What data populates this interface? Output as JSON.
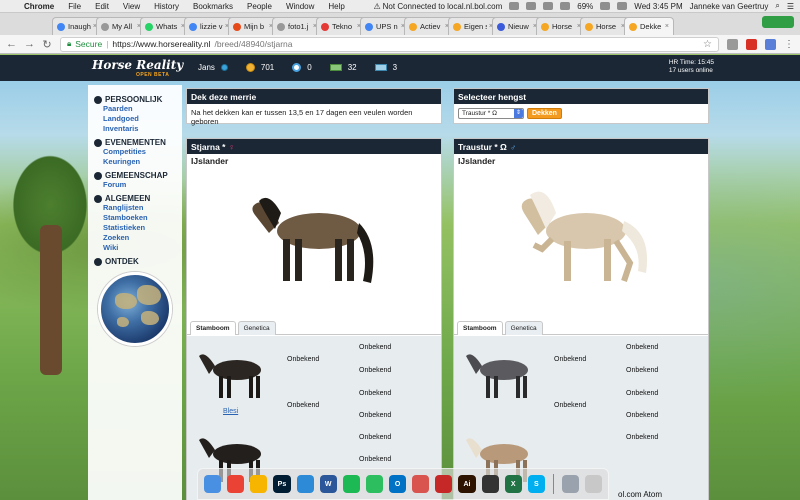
{
  "menubar": {
    "app_name": "Chrome",
    "items": [
      "File",
      "Edit",
      "View",
      "History",
      "Bookmarks",
      "People",
      "Window",
      "Help"
    ],
    "status_text": "Not Connected to local.nl.bol.com",
    "battery": "69%",
    "datetime": "Wed 3:45 PM",
    "user": "Janneke van Geertruy"
  },
  "browser": {
    "tabs": [
      {
        "title": "Inaugh",
        "color": "#4285f4"
      },
      {
        "title": "My All",
        "color": "#999999"
      },
      {
        "title": "Whats",
        "color": "#25d366"
      },
      {
        "title": "lizzie v",
        "color": "#4285f4"
      },
      {
        "title": "Mijn b",
        "color": "#e64a19"
      },
      {
        "title": "foto1.j",
        "color": "#999999"
      },
      {
        "title": "Tekno",
        "color": "#e53935"
      },
      {
        "title": "UPS n",
        "color": "#4285f4"
      },
      {
        "title": "Actiev",
        "color": "#f5a623"
      },
      {
        "title": "Eigen s",
        "color": "#f5a623"
      },
      {
        "title": "Nieuw",
        "color": "#3b5bdb"
      },
      {
        "title": "Horse",
        "color": "#f5a623"
      },
      {
        "title": "Horse",
        "color": "#f5a623"
      },
      {
        "title": "Dekke",
        "color": "#f5a623"
      }
    ],
    "secure_label": "Secure",
    "url_host": "https://www.horsereality.nl",
    "url_path": "/breed/48940/stjarna"
  },
  "site": {
    "logo_text": "Horse Reality",
    "logo_sub": "OPEN BETA",
    "username": "Jans",
    "currency": [
      {
        "icon": "gold-coin",
        "value": "701"
      },
      {
        "icon": "blue-coin",
        "value": "0"
      },
      {
        "icon": "green-money",
        "value": "32"
      },
      {
        "icon": "blue-money",
        "value": "3"
      }
    ],
    "hr_time": "HR Time: 15:45",
    "users_online": "17 users online"
  },
  "sidebar": {
    "sections": [
      {
        "title": "PERSOONLIJK",
        "links": [
          "Paarden",
          "Landgoed",
          "Inventaris"
        ]
      },
      {
        "title": "EVENEMENTEN",
        "links": [
          "Competities",
          "Keuringen"
        ]
      },
      {
        "title": "GEMEENSCHAP",
        "links": [
          "Forum"
        ]
      },
      {
        "title": "ALGEMEEN",
        "links": [
          "Ranglijsten",
          "Stamboeken",
          "Statistieken",
          "Zoeken",
          "Wiki"
        ]
      },
      {
        "title": "ONTDEK",
        "links": []
      }
    ]
  },
  "breed_panel": {
    "title": "Dek deze merrie",
    "message": "Na het dekken kan er tussen 13,5 en 17 dagen een veulen worden geboren"
  },
  "stallion_select": {
    "title": "Selecteer hengst",
    "selected": "Traustur * Ω",
    "button_label": "Dekken"
  },
  "mare": {
    "name": "Stjarna *",
    "gender_symbol": "♀",
    "breed": "IJslander",
    "tabs": [
      "Stamboom",
      "Genetica"
    ],
    "pedigree": {
      "parent_name": "Blesi",
      "cells": [
        "Onbekend",
        "Onbekend",
        "Onbekend",
        "Onbekend",
        "Onbekend",
        "Onbekend",
        "Onbekend",
        "Onbekend"
      ]
    }
  },
  "stallion": {
    "name": "Traustur * Ω",
    "gender_symbol": "♂",
    "breed": "IJslander",
    "tabs": [
      "Stamboom",
      "Genetica"
    ],
    "pedigree": {
      "cells": [
        "Onbekend",
        "Onbekend",
        "Onbekend",
        "Onbekend",
        "Onbekend",
        "Onbekend",
        "Onbekend"
      ]
    }
  },
  "dock": {
    "apps": [
      {
        "name": "finder",
        "color": "#4a90e2",
        "label": ""
      },
      {
        "name": "chrome",
        "color": "#ea4335",
        "label": ""
      },
      {
        "name": "sketch",
        "color": "#f7b500",
        "label": ""
      },
      {
        "name": "photoshop",
        "color": "#001d34",
        "label": "Ps"
      },
      {
        "name": "skype-blue",
        "color": "#2c8ad6",
        "label": ""
      },
      {
        "name": "word",
        "color": "#2b579a",
        "label": "W"
      },
      {
        "name": "spotify",
        "color": "#1db954",
        "label": ""
      },
      {
        "name": "evernote",
        "color": "#2dbe60",
        "label": ""
      },
      {
        "name": "outlook",
        "color": "#0072c6",
        "label": "O"
      },
      {
        "name": "wunderlist",
        "color": "#d9534f",
        "label": ""
      },
      {
        "name": "acrobat",
        "color": "#c62828",
        "label": ""
      },
      {
        "name": "illustrator",
        "color": "#2d1300",
        "label": "Ai"
      },
      {
        "name": "terminal",
        "color": "#333333",
        "label": ""
      },
      {
        "name": "excel",
        "color": "#217346",
        "label": "X"
      },
      {
        "name": "skype",
        "color": "#00aff0",
        "label": "S"
      },
      {
        "name": "preview",
        "color": "#9aa3ad",
        "label": ""
      },
      {
        "name": "trash",
        "color": "#c8c8c8",
        "label": ""
      }
    ]
  },
  "background_text": "ol.com Atom"
}
